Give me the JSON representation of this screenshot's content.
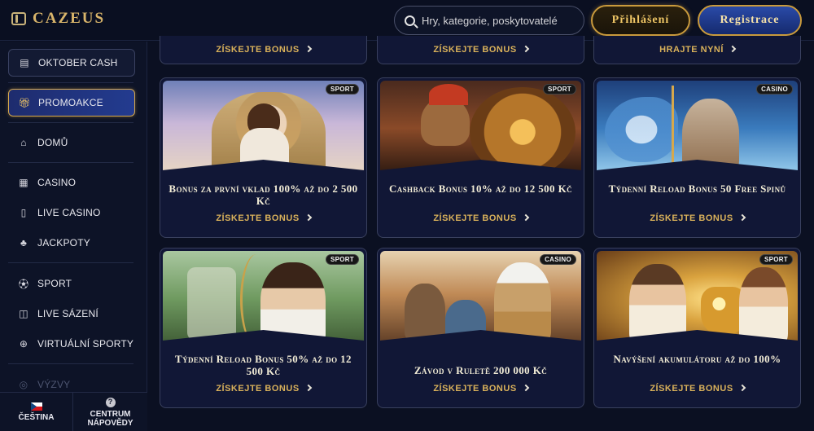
{
  "header": {
    "logo_text": "CAZEUS",
    "search_placeholder": "Hry, kategorie, poskytovatelé",
    "login_label": "Přihlášení",
    "register_label": "Registrace"
  },
  "sidebar": {
    "items": [
      {
        "label": "OKTOBER CASH",
        "icon": "gift-box-icon"
      },
      {
        "label": "PROMOAKCE",
        "icon": "gift-icon"
      },
      {
        "label": "DOMŮ",
        "icon": "home-icon"
      },
      {
        "label": "CASINO",
        "icon": "slot-machine-icon"
      },
      {
        "label": "LIVE CASINO",
        "icon": "cards-icon"
      },
      {
        "label": "JACKPOTY",
        "icon": "clover-icon"
      },
      {
        "label": "SPORT",
        "icon": "soccer-ball-icon"
      },
      {
        "label": "LIVE SÁZENÍ",
        "icon": "live-icon"
      },
      {
        "label": "VIRTUÁLNÍ SPORTY",
        "icon": "gamepad-icon"
      },
      {
        "label": "VÝZVY",
        "icon": "challenge-icon"
      }
    ],
    "footer": {
      "language": "ČEŠTINA",
      "help_line1": "CENTRUM",
      "help_line2": "NÁPOVĚDY"
    }
  },
  "top_row": [
    {
      "cta": "ZÍSKEJTE BONUS"
    },
    {
      "cta": "ZÍSKEJTE BONUS"
    },
    {
      "cta": "HRAJTE NYNÍ"
    }
  ],
  "cards": [
    {
      "badge": "SPORT",
      "title": "Bonus za první vklad 100% až do 2 500 Kč",
      "cta": "ZÍSKEJTE BONUS"
    },
    {
      "badge": "SPORT",
      "title": "Cashback Bonus 10% až do 12 500 Kč",
      "cta": "ZÍSKEJTE BONUS"
    },
    {
      "badge": "CASINO",
      "title": "Týdenní Reload Bonus 50 Free Spinů",
      "cta": "ZÍSKEJTE BONUS"
    },
    {
      "badge": "SPORT",
      "title": "Týdenní Reload Bonus 50% až do 12 500 Kč",
      "cta": "ZÍSKEJTE BONUS"
    },
    {
      "badge": "CASINO",
      "title": "Závod v Ruletě 200 000 Kč",
      "cta": "ZÍSKEJTE BONUS"
    },
    {
      "badge": "SPORT",
      "title": "Navýšení akumulátoru až do 100%",
      "cta": "ZÍSKEJTE BONUS"
    }
  ],
  "colors": {
    "accent_gold": "#d9b15a",
    "background": "#0b1022",
    "active_blue": "#233b8f"
  }
}
